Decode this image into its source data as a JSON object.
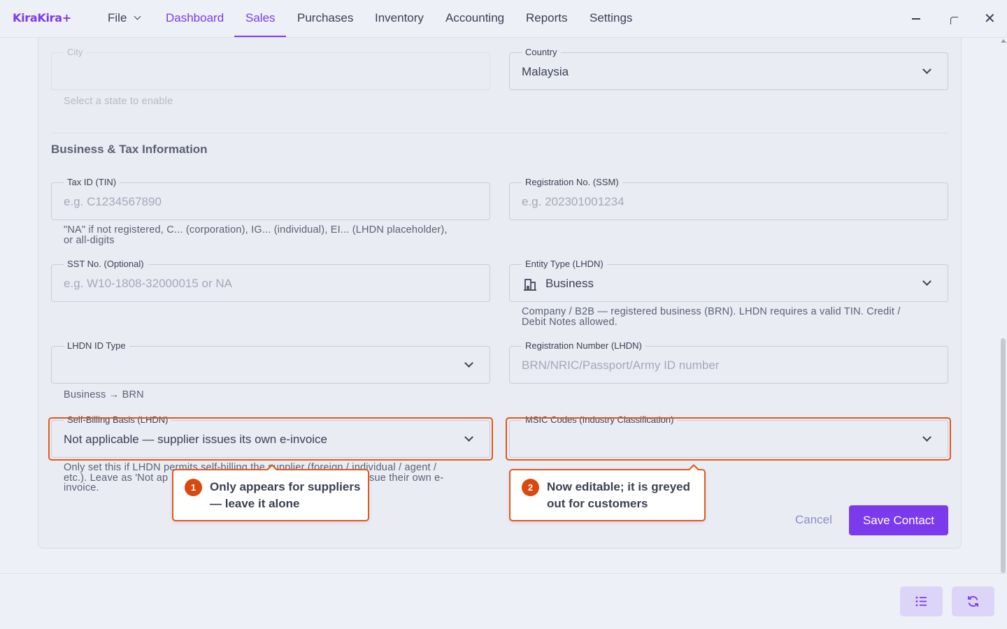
{
  "app": {
    "name": "KiraKira+"
  },
  "nav": {
    "file": "File",
    "dashboard": "Dashboard",
    "sales": "Sales",
    "purchases": "Purchases",
    "inventory": "Inventory",
    "accounting": "Accounting",
    "reports": "Reports",
    "settings": "Settings",
    "active": "Sales"
  },
  "window_controls": {
    "minimize_icon": "minimize-icon",
    "restore_icon": "restore-icon",
    "close_icon": "close-icon"
  },
  "form": {
    "city": {
      "label": "City",
      "value": "",
      "helper": "Select a state to enable"
    },
    "country": {
      "label": "Country",
      "value": "Malaysia"
    },
    "section_title": "Business & Tax Information",
    "tin": {
      "label": "Tax ID (TIN)",
      "placeholder": "e.g. C1234567890",
      "helper_line1": "\"NA\" if not registered, C... (corporation), IG... (individual), EI... (LHDN placeholder),",
      "helper_line2": "or all-digits"
    },
    "ssm": {
      "label": "Registration No. (SSM)",
      "placeholder": "e.g. 202301001234"
    },
    "sst": {
      "label": "SST No. (Optional)",
      "placeholder": "e.g. W10-1808-32000015 or NA"
    },
    "entity_type": {
      "label": "Entity Type (LHDN)",
      "value": "Business",
      "icon": "building-icon",
      "helper_line1": "Company / B2B — registered business (BRN). LHDN requires a valid TIN. Credit /",
      "helper_line2": "Debit Notes allowed."
    },
    "lhdn_id_type": {
      "label": "LHDN ID Type",
      "value": "",
      "helper": "Business → BRN"
    },
    "registration_number": {
      "label": "Registration Number (LHDN)",
      "placeholder": "BRN/NRIC/Passport/Army ID number"
    },
    "self_billing": {
      "label": "Self-Billing Basis (LHDN)",
      "value": "Not applicable — supplier issues its own e-invoice",
      "helper_line1": "Only set this if LHDN permits self-billing the supplier (foreign / individual / agent /",
      "helper_line2": "etc.). Leave as 'Not ap",
      "helper_line2_end": "sue their own e-",
      "helper_line3": "invoice."
    },
    "msic": {
      "label": "MSIC Codes (Industry Classification)",
      "value": ""
    },
    "cancel_label": "Cancel",
    "save_label": "Save Contact"
  },
  "callouts": [
    {
      "number": "1",
      "line1": "Only appears for suppliers",
      "line2": "— leave it alone"
    },
    {
      "number": "2",
      "line1": "Now editable; it is greyed",
      "line2": "out for customers"
    }
  ],
  "fabs": {
    "list_icon": "list-icon",
    "refresh_icon": "refresh-icon"
  },
  "colors": {
    "accent": "#7c3aed",
    "highlight": "#e2571c",
    "badge": "#d9480f"
  }
}
